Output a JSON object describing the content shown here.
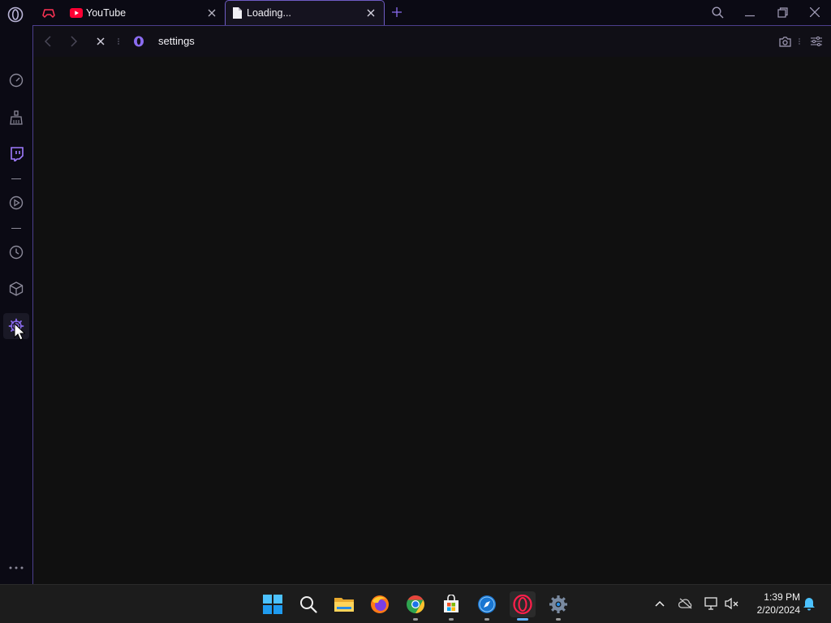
{
  "browser": {
    "tabs": [
      {
        "id": "gx",
        "title": ""
      },
      {
        "id": "youtube",
        "title": "YouTube"
      },
      {
        "id": "loading",
        "title": "Loading..."
      }
    ],
    "address": {
      "url": "settings"
    }
  },
  "taskbar": {
    "clock": {
      "time": "1:39 PM",
      "date": "2/20/2024"
    }
  },
  "colors": {
    "accent": "#8b6cf0",
    "youtube_red": "#ff0033",
    "gx_red": "#ff3355",
    "taskbar_active": "#5fb2ff"
  }
}
